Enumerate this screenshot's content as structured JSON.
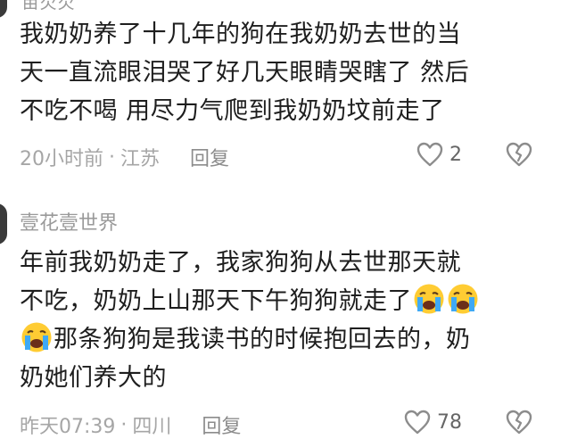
{
  "comment1": {
    "username_partial": "苗芡芡",
    "lines": [
      "我奶奶养了十几年的狗在我奶奶去世的当",
      "天一直流眼泪哭了好几天眼睛哭瞎了 然后",
      "不吃不喝  用尽力气爬到我奶奶坟前走了"
    ],
    "time": "20小时前",
    "separator": "·",
    "location": "江苏",
    "reply_label": "回复",
    "like_count": "2"
  },
  "comment2": {
    "username": "壹花壹世界",
    "line1": "年前我奶奶走了，我家狗狗从去世那天就",
    "line2": "不吃，奶奶上山那天下午狗狗就走了",
    "line3": "那条狗狗是我读书的时候抱回去的，奶",
    "line4": "奶她们养大的",
    "time": "昨天07:39",
    "separator": "·",
    "location": "四川",
    "reply_label": "回复",
    "like_count": "78"
  },
  "icons": {
    "like": "heart-outline-icon",
    "dislike": "broken-heart-icon",
    "emoji": "loudly-crying-face-emoji"
  },
  "colors": {
    "text": "#1e1e1e",
    "meta": "#a6a6a6",
    "emoji_face": "#ffcc33",
    "tears": "#3fa9f5"
  }
}
